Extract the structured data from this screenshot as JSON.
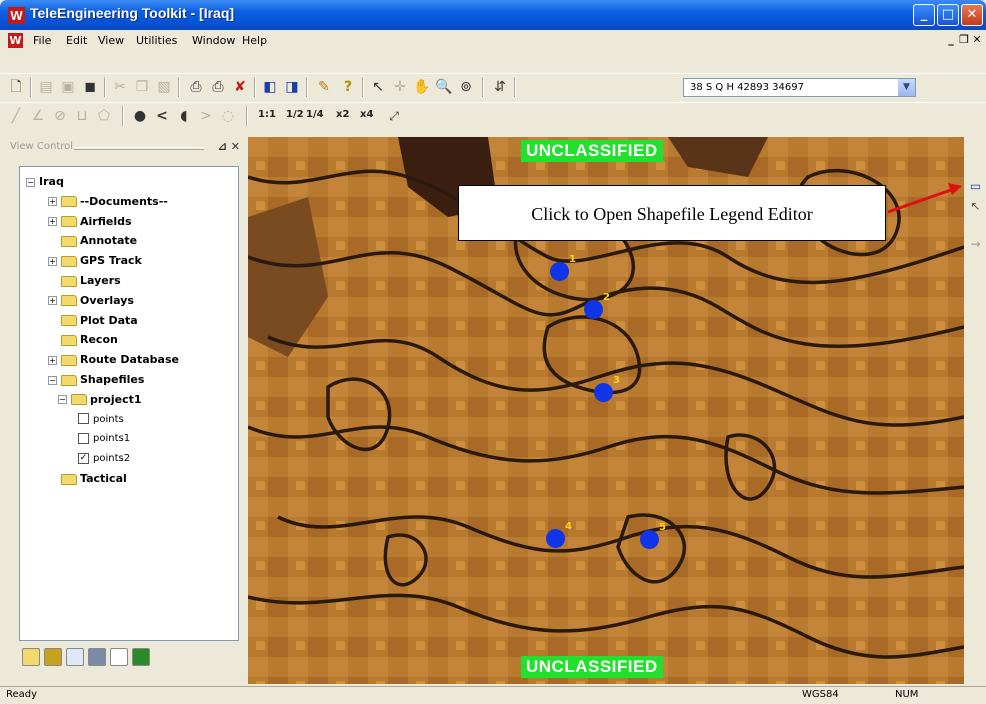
{
  "window": {
    "title": "TeleEngineering Toolkit - [Iraq]",
    "icon": "app-logo-icon"
  },
  "menu": [
    "File",
    "Edit",
    "View",
    "Utilities",
    "Window",
    "Help"
  ],
  "toolbar": {
    "coordinate": "38 S Q H 42893 34697",
    "zoom_labels": [
      "1:1",
      "1/2",
      "1/4",
      "x2",
      "x4"
    ]
  },
  "panel": {
    "caption": "View Control",
    "tree": [
      {
        "label": "Iraq",
        "level": 0,
        "expander": "minus"
      },
      {
        "label": "--Documents--",
        "level": 1,
        "expander": "plus"
      },
      {
        "label": "Airfields",
        "level": 1,
        "expander": "plus"
      },
      {
        "label": "Annotate",
        "level": 1,
        "expander": ""
      },
      {
        "label": "GPS Track",
        "level": 1,
        "expander": "plus"
      },
      {
        "label": "Layers",
        "level": 1,
        "expander": ""
      },
      {
        "label": "Overlays",
        "level": 1,
        "expander": "plus"
      },
      {
        "label": "Plot Data",
        "level": 1,
        "expander": ""
      },
      {
        "label": "Recon",
        "level": 1,
        "expander": ""
      },
      {
        "label": "Route Database",
        "level": 1,
        "expander": "plus"
      },
      {
        "label": "Shapefiles",
        "level": 1,
        "expander": "minus"
      },
      {
        "label": "project1",
        "level": 2,
        "expander": "minus"
      },
      {
        "label": "points",
        "level": 3,
        "checkbox": false
      },
      {
        "label": "points1",
        "level": 3,
        "checkbox": false
      },
      {
        "label": "points2",
        "level": 3,
        "checkbox": true
      },
      {
        "label": "Tactical",
        "level": 1,
        "expander": ""
      }
    ]
  },
  "map": {
    "banner_top": "UNCLASSIFIED",
    "banner_bottom": "UNCLASSIFIED",
    "callout": "Click to Open Shapefile Legend Editor",
    "markers": [
      "1",
      "2",
      "3",
      "4",
      "5"
    ]
  },
  "status": {
    "left": "Ready",
    "datum": "WGS84",
    "numlock": "NUM"
  },
  "colors": {
    "map_base": "#b97a2c",
    "banner": "#22e02e",
    "marker": "#1034e8",
    "callout_arrow": "#e01010"
  }
}
